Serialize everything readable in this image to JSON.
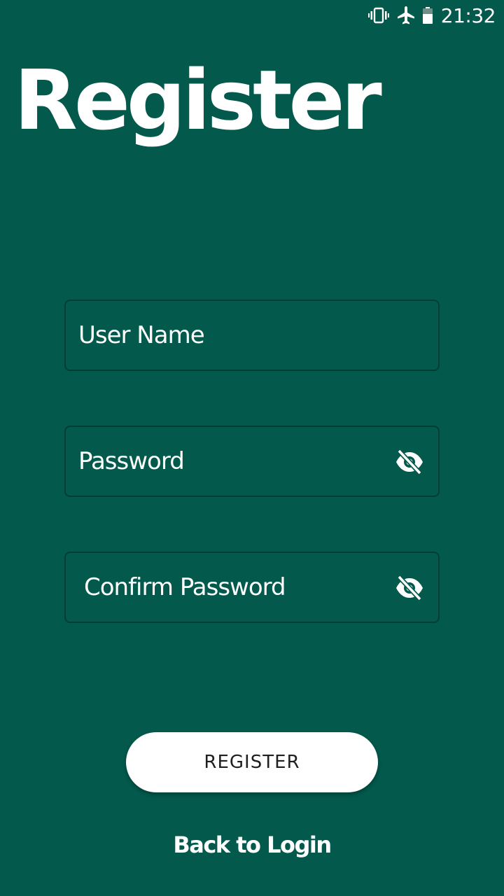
{
  "status_bar": {
    "time": "21:32",
    "icons": [
      "vibrate-icon",
      "airplane-mode-icon",
      "battery-icon"
    ]
  },
  "title": "Register",
  "form": {
    "username_placeholder": "User Name",
    "password_placeholder": "Password",
    "confirm_password_placeholder": "Confirm Password"
  },
  "register_button_label": "REGISTER",
  "back_link_label": "Back to Login",
  "colors": {
    "background": "#02594c",
    "field_border": "#013d33",
    "button_bg": "#ffffff",
    "text": "#ffffff"
  }
}
